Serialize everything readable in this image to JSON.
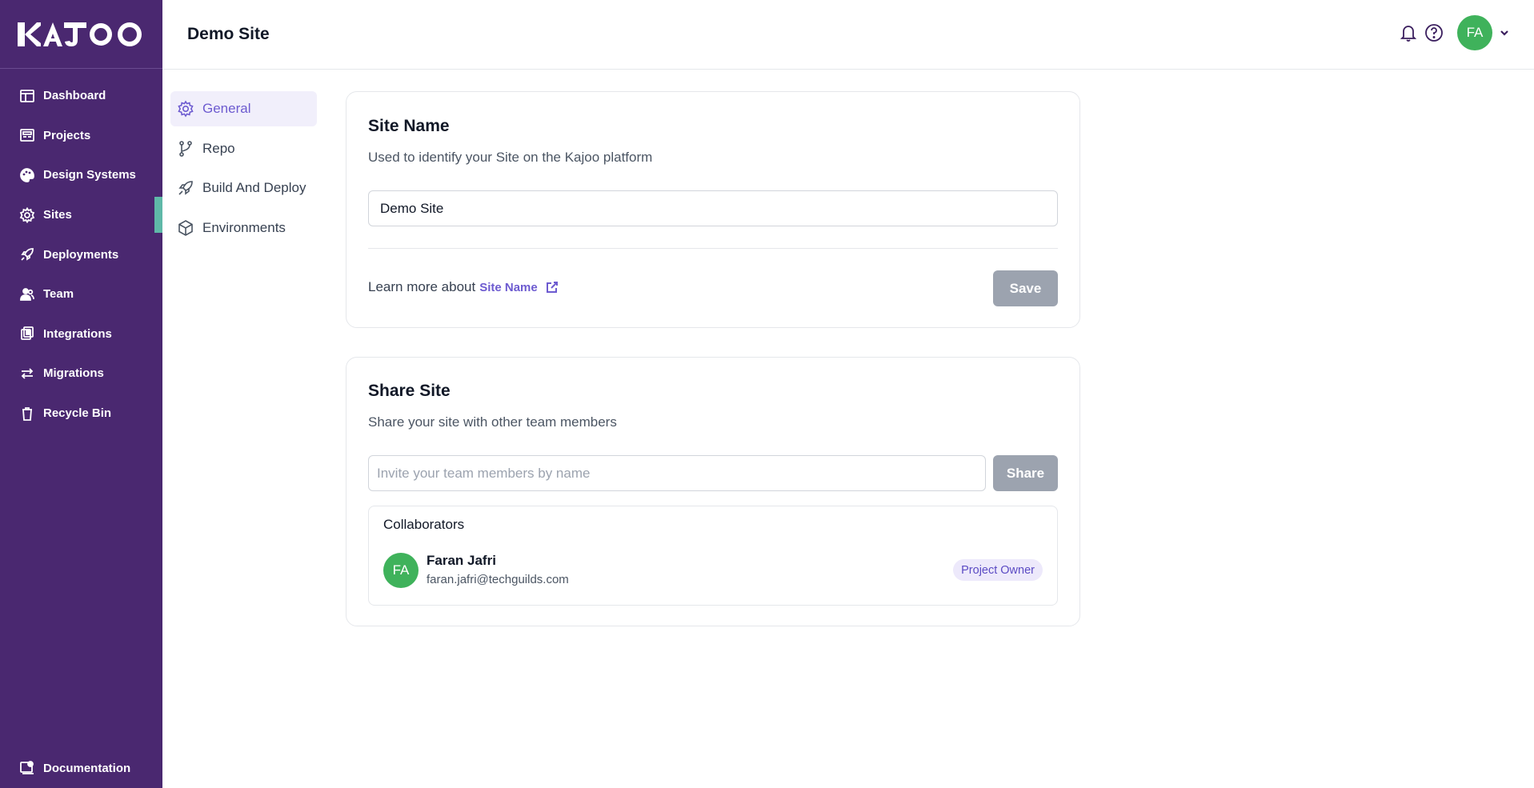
{
  "app": {
    "brand": "KAJOO",
    "brand_letters": [
      "K",
      "A",
      "J",
      "O",
      "O"
    ]
  },
  "sidebar": {
    "items": [
      {
        "label": "Dashboard",
        "icon": "dashboard-icon"
      },
      {
        "label": "Projects",
        "icon": "projects-icon"
      },
      {
        "label": "Design Systems",
        "icon": "palette-icon"
      },
      {
        "label": "Sites",
        "icon": "gear-icon",
        "active": true
      },
      {
        "label": "Deployments",
        "icon": "rocket-icon"
      },
      {
        "label": "Team",
        "icon": "team-icon"
      },
      {
        "label": "Integrations",
        "icon": "integrations-icon"
      },
      {
        "label": "Migrations",
        "icon": "migrate-icon"
      },
      {
        "label": "Recycle Bin",
        "icon": "trash-icon"
      }
    ],
    "documentation": "Documentation",
    "colors": {
      "background": "#4a2870",
      "active_marker": "#5fb8a8"
    }
  },
  "header": {
    "title": "Demo Site",
    "user_initials": "FA",
    "icons": [
      "bell-icon",
      "help-icon",
      "chevron-down-icon"
    ]
  },
  "subnav": {
    "items": [
      {
        "label": "General",
        "icon": "gear-icon",
        "active": true
      },
      {
        "label": "Repo",
        "icon": "branch-icon"
      },
      {
        "label": "Build And Deploy",
        "icon": "rocket-icon"
      },
      {
        "label": "Environments",
        "icon": "cube-icon"
      }
    ]
  },
  "site_name_card": {
    "title": "Site Name",
    "description": "Used to identify your Site on the Kajoo platform",
    "input_value": "Demo Site",
    "learn_prefix": "Learn more about",
    "learn_link": "Site Name",
    "save_label": "Save"
  },
  "share_card": {
    "title": "Share Site",
    "description": "Share your site with other team members",
    "input_placeholder": "Invite your team members by name",
    "share_label": "Share",
    "collaborators_title": "Collaborators",
    "collaborators": [
      {
        "initials": "FA",
        "name": "Faran Jafri",
        "email": "faran.jafri@techguilds.com",
        "role": "Project Owner"
      }
    ]
  },
  "colors": {
    "accent": "#6d5bd0",
    "avatar": "#3fb25b",
    "button_disabled": "#9ca3af"
  }
}
